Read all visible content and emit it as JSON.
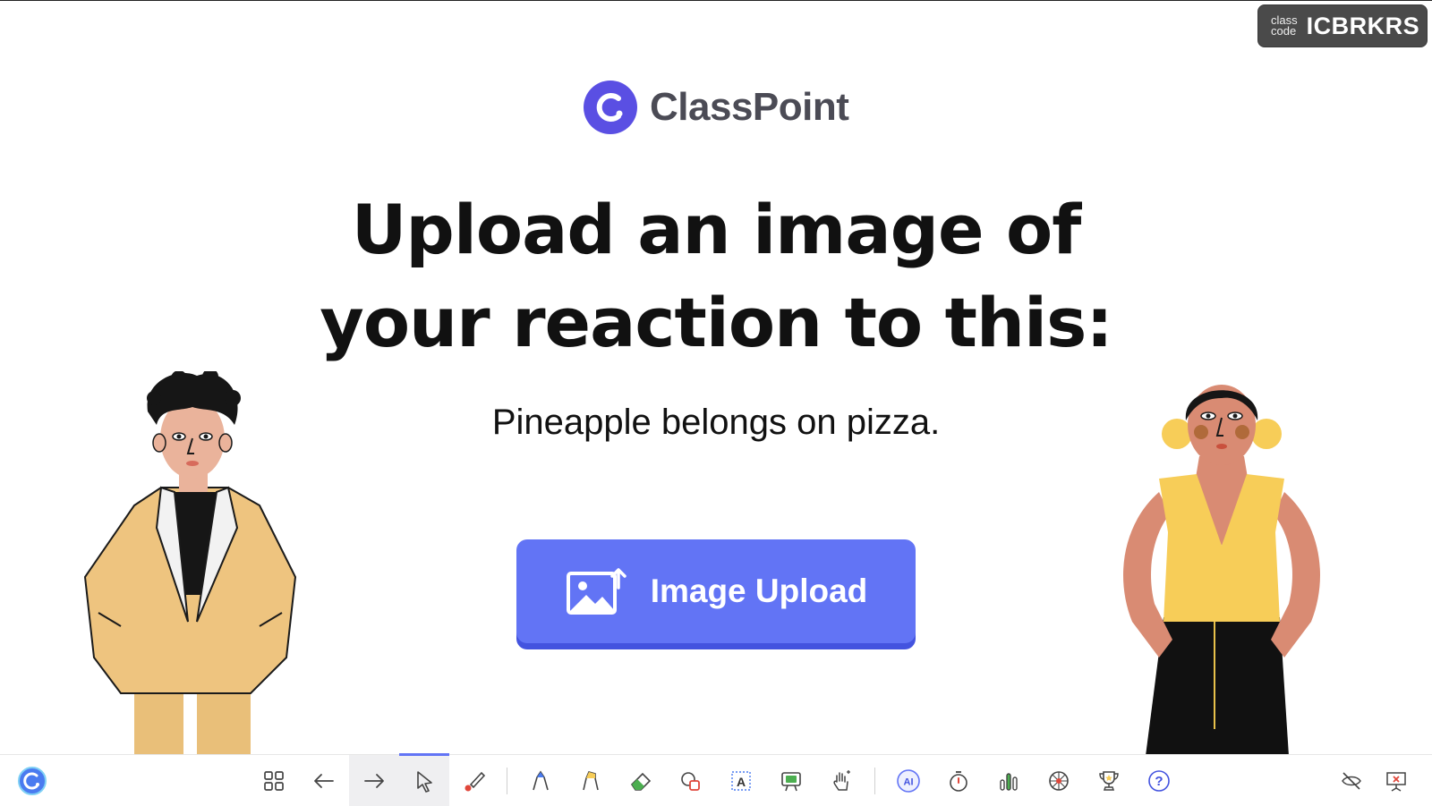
{
  "class_code": {
    "label_line1": "class",
    "label_line2": "code",
    "code": "ICBRKRS"
  },
  "logo": {
    "brand": "ClassPoint"
  },
  "slide": {
    "title_line1": "Upload an image of",
    "title_line2": "your reaction to this:",
    "subtitle": "Pineapple belongs on pizza.",
    "button_label": "Image Upload"
  },
  "colors": {
    "accent": "#6274f5",
    "accent_dark": "#4353df",
    "badge_bg": "#4a4a4a"
  },
  "toolbar": {
    "icons": [
      "classpoint-logo-icon",
      "slides-grid-icon",
      "previous-slide-icon",
      "next-slide-icon",
      "pointer-icon",
      "laser-pointer-icon",
      "pen-icon",
      "highlighter-icon",
      "eraser-icon",
      "shapes-icon",
      "text-box-icon",
      "whiteboard-icon",
      "drag-objects-icon",
      "ai-icon",
      "timer-icon",
      "quick-poll-icon",
      "name-picker-wheel-icon",
      "award-stars-icon",
      "help-icon",
      "hide-toolbar-icon",
      "end-slideshow-icon"
    ]
  }
}
